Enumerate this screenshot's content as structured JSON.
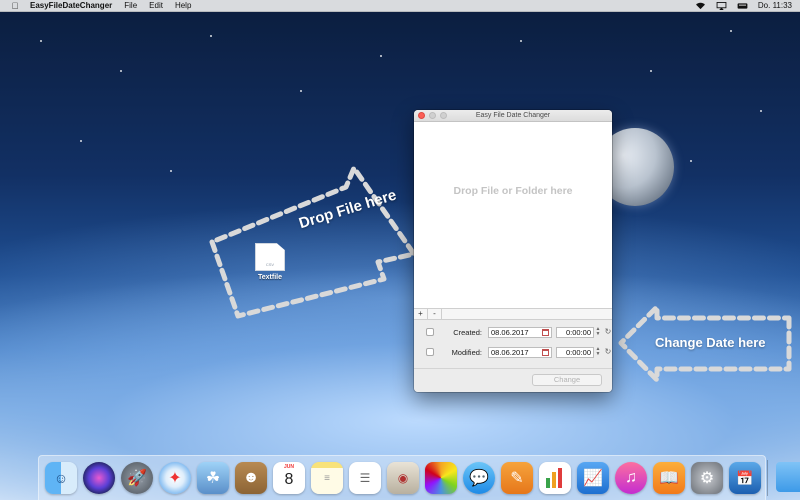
{
  "menubar": {
    "app_name": "EasyFileDateChanger",
    "menus": [
      "File",
      "Edit",
      "Help"
    ],
    "clock": "Do. 11:33",
    "status_icons": [
      "wifi-icon",
      "airplay-icon",
      "keyboard-icon"
    ]
  },
  "desktop": {
    "file_name": "Textfile",
    "file_ext": "CSV",
    "hint_drop_file": "Drop File here",
    "hint_change_date": "Change Date here"
  },
  "window": {
    "title": "Easy File Date Changer",
    "drop_label": "Drop File or Folder here",
    "add_label": "+",
    "remove_label": "-",
    "created_label": "Created:",
    "created_date": "08.06.2017",
    "created_time": "0:00:00",
    "modified_label": "Modified:",
    "modified_date": "08.06.2017",
    "modified_time": "0:00:00",
    "change_button": "Change"
  },
  "dock": {
    "calendar_month": "JUN",
    "calendar_day": "8",
    "items": [
      "finder-icon",
      "siri-icon",
      "launchpad-icon",
      "safari-icon",
      "preview-icon",
      "contacts-icon",
      "calendar-icon",
      "notes-icon",
      "reminders-icon",
      "photo-booth-icon",
      "photos-icon",
      "messages-icon",
      "pages-icon",
      "numbers-icon",
      "keynote-icon",
      "itunes-icon",
      "ibooks-icon",
      "system-preferences-icon",
      "easyfiledatechanger-icon",
      "downloads-folder-icon"
    ]
  },
  "colors": {
    "hint_dash": "#d9d9d9",
    "drop_zone_dash": "#bdbdbd",
    "close_button": "#fc5f57"
  }
}
